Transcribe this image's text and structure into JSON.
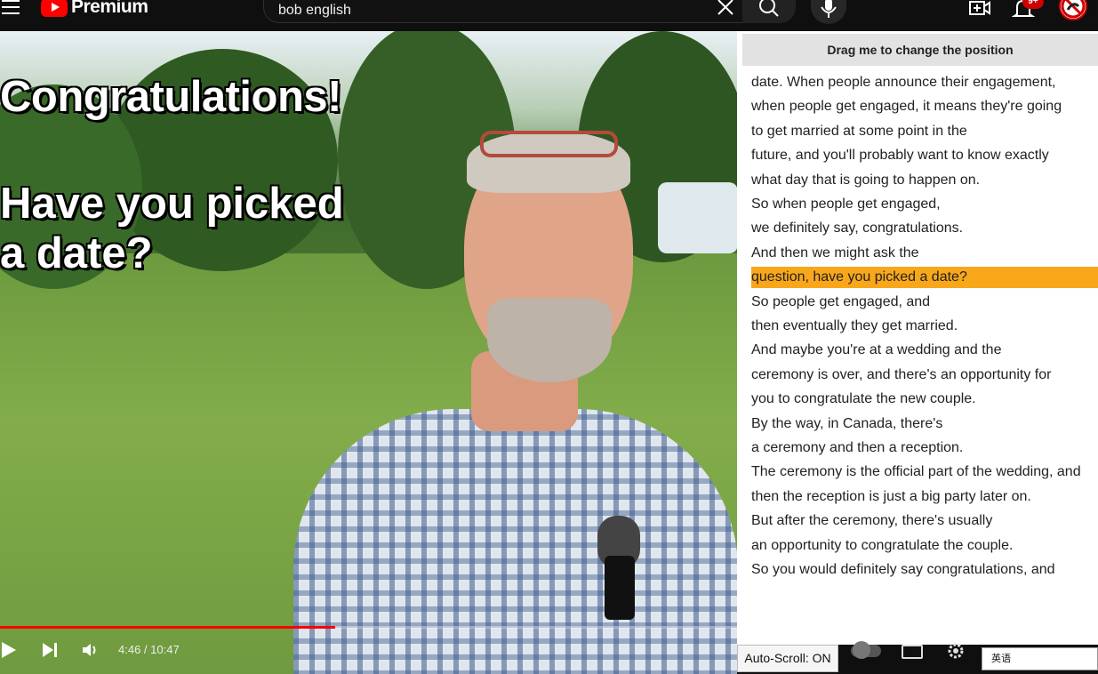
{
  "header": {
    "logo_text": "Premium",
    "search": {
      "value": "bob english",
      "placeholder": "Search"
    },
    "notification_badge": "9+"
  },
  "video": {
    "overlay_line1": "Congratulations!",
    "overlay_line2": "Have you picked",
    "overlay_line3": "a date?",
    "time_display": "4:46 / 10:47",
    "progress_fraction": 0.455
  },
  "transcript_panel": {
    "drag_label": "Drag me to change the position",
    "lines": [
      "date. When people announce their engagement,",
      "when people get engaged, it means they're going",
      "to get married at some point in the",
      "future, and you'll probably want to know exactly",
      "what day that is going to happen on.",
      "So when people get engaged,",
      "we definitely say, congratulations.",
      "And then we might ask the",
      "question, have you picked a date?",
      "So people get engaged, and",
      "then eventually they get married.",
      "And maybe you're at a wedding and the",
      "ceremony is over, and there's an opportunity for",
      "you to congratulate the new couple.",
      "By the way, in Canada, there's",
      "a ceremony and then a reception.",
      "The ceremony is the official part of the wedding, and",
      "then the reception is just a big party later on.",
      "But after the ceremony, there's usually",
      "an opportunity to congratulate the couple.",
      "So you would definitely say congratulations, and"
    ],
    "active_index": 8,
    "autoscroll_label": "Auto-Scroll: ON",
    "language": "英语"
  },
  "colors": {
    "brand_red": "#ff0000",
    "highlight": "#f9a71a"
  }
}
